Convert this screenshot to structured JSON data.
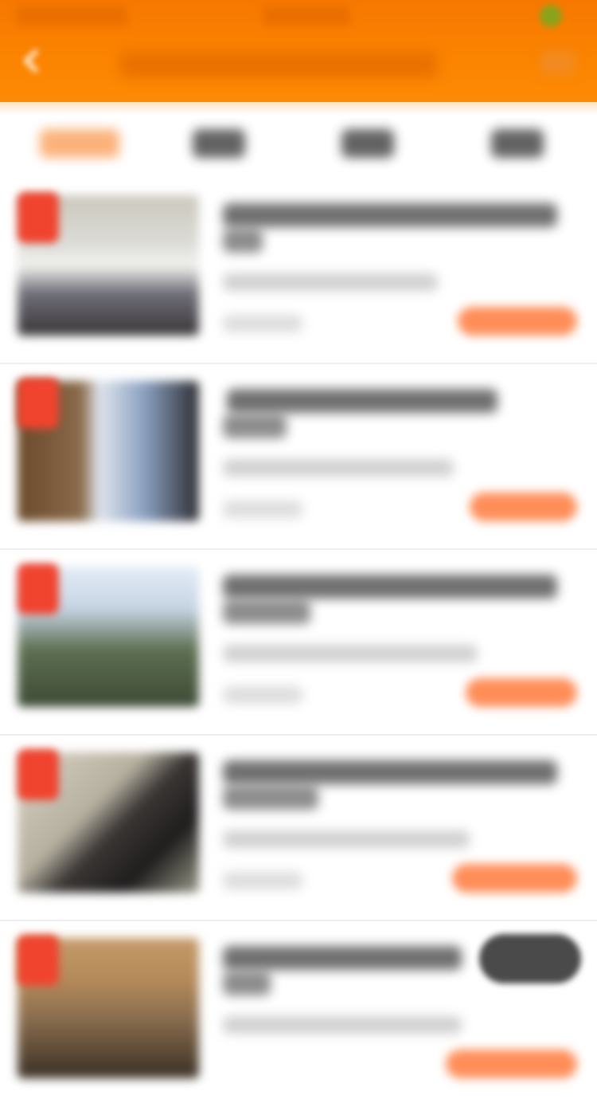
{
  "colors": {
    "header_orange": "#fb8400",
    "accent_red": "#f0442f",
    "action_orange": "#ff7a3c",
    "text_dark": "#404040"
  },
  "header": {
    "status_left": "",
    "status_center": "",
    "title": "",
    "back_icon": "chevron-left-icon",
    "more_icon": "more-icon"
  },
  "tabs": [
    {
      "label": "",
      "active": true
    },
    {
      "label": "",
      "active": false
    },
    {
      "label": "",
      "active": false
    },
    {
      "label": "",
      "active": false
    }
  ],
  "items": [
    {
      "title": "",
      "subtitle": "",
      "meta": "",
      "button": ""
    },
    {
      "title": "",
      "subtitle": "",
      "meta": "",
      "button": ""
    },
    {
      "title": "",
      "subtitle": "",
      "meta": "",
      "button": ""
    },
    {
      "title": "",
      "subtitle": "",
      "meta": "",
      "button": ""
    },
    {
      "title": "",
      "subtitle": "",
      "meta": "",
      "button": ""
    }
  ]
}
